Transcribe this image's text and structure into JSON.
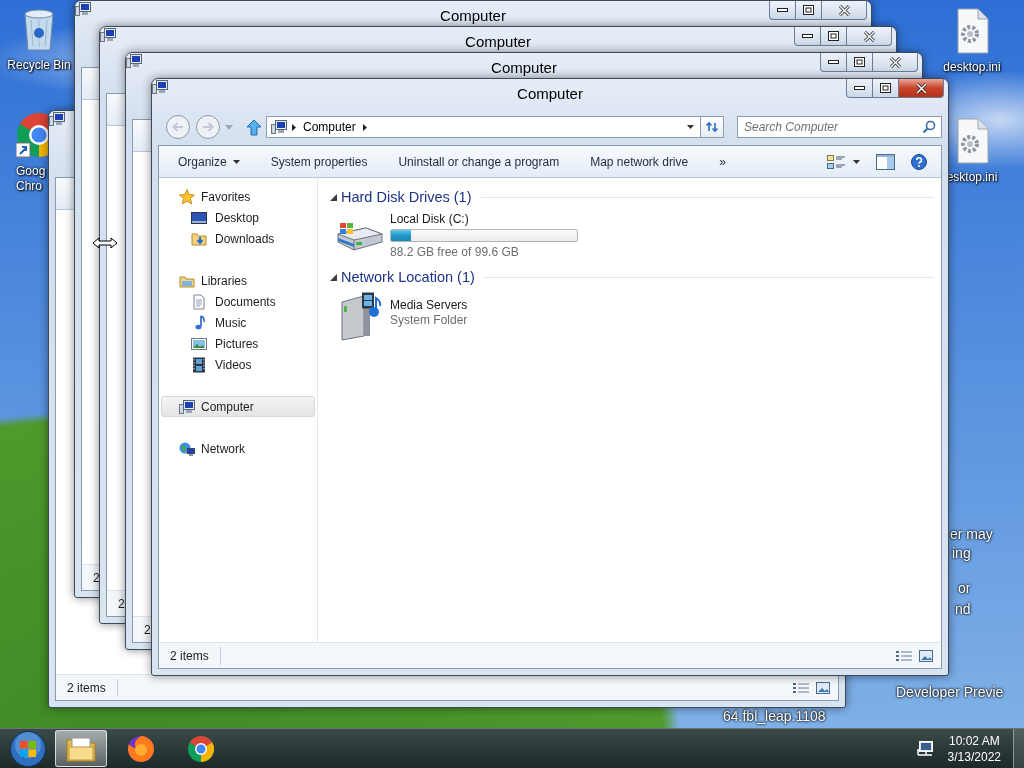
{
  "desktop_icons": [
    {
      "kind": "recycle-bin",
      "lines": [
        "Recycle Bin"
      ]
    },
    {
      "kind": "chrome",
      "lines": [
        "Goog",
        "Chro"
      ]
    },
    {
      "kind": "settings-file",
      "lines": [
        "desktop.ini"
      ]
    },
    {
      "kind": "settings-file",
      "lines": [
        "esktop.ini"
      ]
    }
  ],
  "wallpaper_texts": [
    "er may",
    "ing",
    "or",
    "nd",
    "Developer Previe",
    "64.fbl_leap.1108"
  ],
  "back_windows": [
    {
      "status": "2 items",
      "view_switch": true
    },
    {
      "title": "Computer",
      "status": "2"
    },
    {
      "title": "Computer",
      "status": "2"
    },
    {
      "title": "Computer",
      "status": "2"
    }
  ],
  "window": {
    "title": "Computer",
    "address": [
      "Computer"
    ],
    "search": {
      "placeholder": "Search Computer"
    },
    "commands": [
      {
        "label": "Organize",
        "kind": "menu"
      },
      {
        "label": "System properties",
        "kind": "command"
      },
      {
        "label": "Uninstall or change a program",
        "kind": "command"
      },
      {
        "label": "Map network drive",
        "kind": "command"
      },
      {
        "label": "»",
        "kind": "overflow"
      }
    ],
    "sidebar": [
      {
        "label": "Favorites",
        "kind": "star",
        "selected": false,
        "children": [
          {
            "label": "Desktop",
            "kind": "desktop",
            "selected": false
          },
          {
            "label": "Downloads",
            "kind": "downloads",
            "selected": false
          }
        ]
      },
      {
        "label": "Libraries",
        "kind": "libraries",
        "selected": false,
        "children": [
          {
            "label": "Documents",
            "kind": "documents",
            "selected": false
          },
          {
            "label": "Music",
            "kind": "music",
            "selected": false
          },
          {
            "label": "Pictures",
            "kind": "pictures",
            "selected": false
          },
          {
            "label": "Videos",
            "kind": "videos",
            "selected": false
          }
        ]
      },
      {
        "label": "Computer",
        "kind": "computer",
        "selected": true
      },
      {
        "label": "Network",
        "kind": "network",
        "selected": false
      }
    ],
    "groups": [
      {
        "label": "Hard Disk Drives (1)",
        "expanded": true,
        "items": [
          {
            "kind": "drive",
            "name": "Local Disk (C:)",
            "level": 0.11,
            "detail": "88.2 GB free of 99.6 GB"
          }
        ]
      },
      {
        "label": "Network Location (1)",
        "expanded": true,
        "items": [
          {
            "kind": "media-server",
            "name": "Media Servers",
            "detail": "System Folder"
          }
        ]
      }
    ],
    "status": "2 items"
  },
  "taskbar": {
    "apps": [
      {
        "kind": "explorer",
        "selected": true
      },
      {
        "kind": "firefox",
        "selected": false
      },
      {
        "kind": "chrome",
        "selected": false
      }
    ],
    "time": "10:02 AM",
    "date": "3/13/2022"
  }
}
